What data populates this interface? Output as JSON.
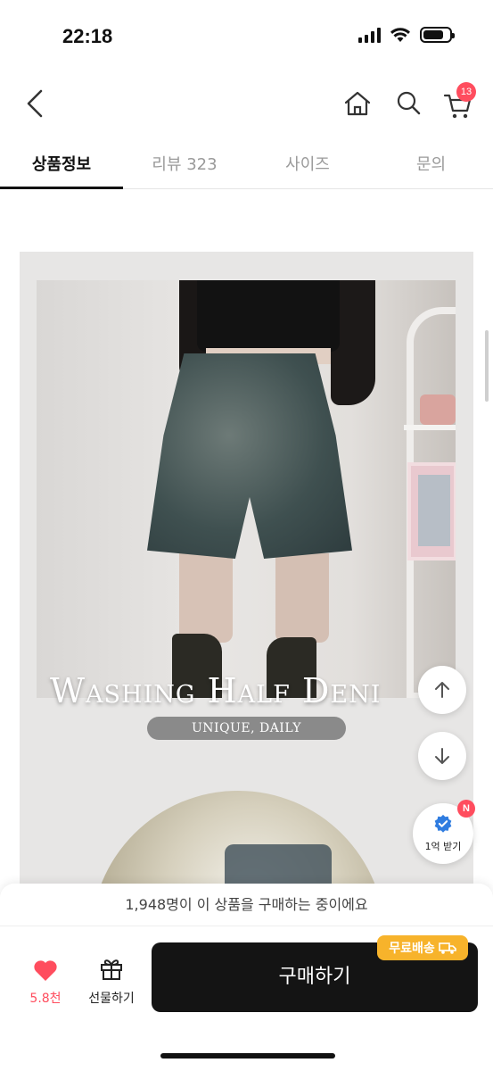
{
  "status_bar": {
    "time": "22:18"
  },
  "header": {
    "cart_count": "13"
  },
  "tabs": [
    {
      "label": "상품정보",
      "active": true
    },
    {
      "label": "리뷰 323",
      "active": false
    },
    {
      "label": "사이즈",
      "active": false
    },
    {
      "label": "문의",
      "active": false
    }
  ],
  "product_image": {
    "title": "Washing Half Deni",
    "subtitle": "UNIQUE, DAILY"
  },
  "floating": {
    "coupon_label": "1억 받기",
    "coupon_badge": "N"
  },
  "bottom_bar": {
    "buying_text": "1,948명이 이 상품을 구매하는 중이에요",
    "like_count": "5.8천",
    "gift_label": "선물하기",
    "buy_label": "구매하기",
    "free_shipping_label": "무료배송"
  },
  "colors": {
    "accent_red": "#ff4d5e",
    "buy_button": "#141414",
    "free_shipping": "#f7b32b"
  }
}
